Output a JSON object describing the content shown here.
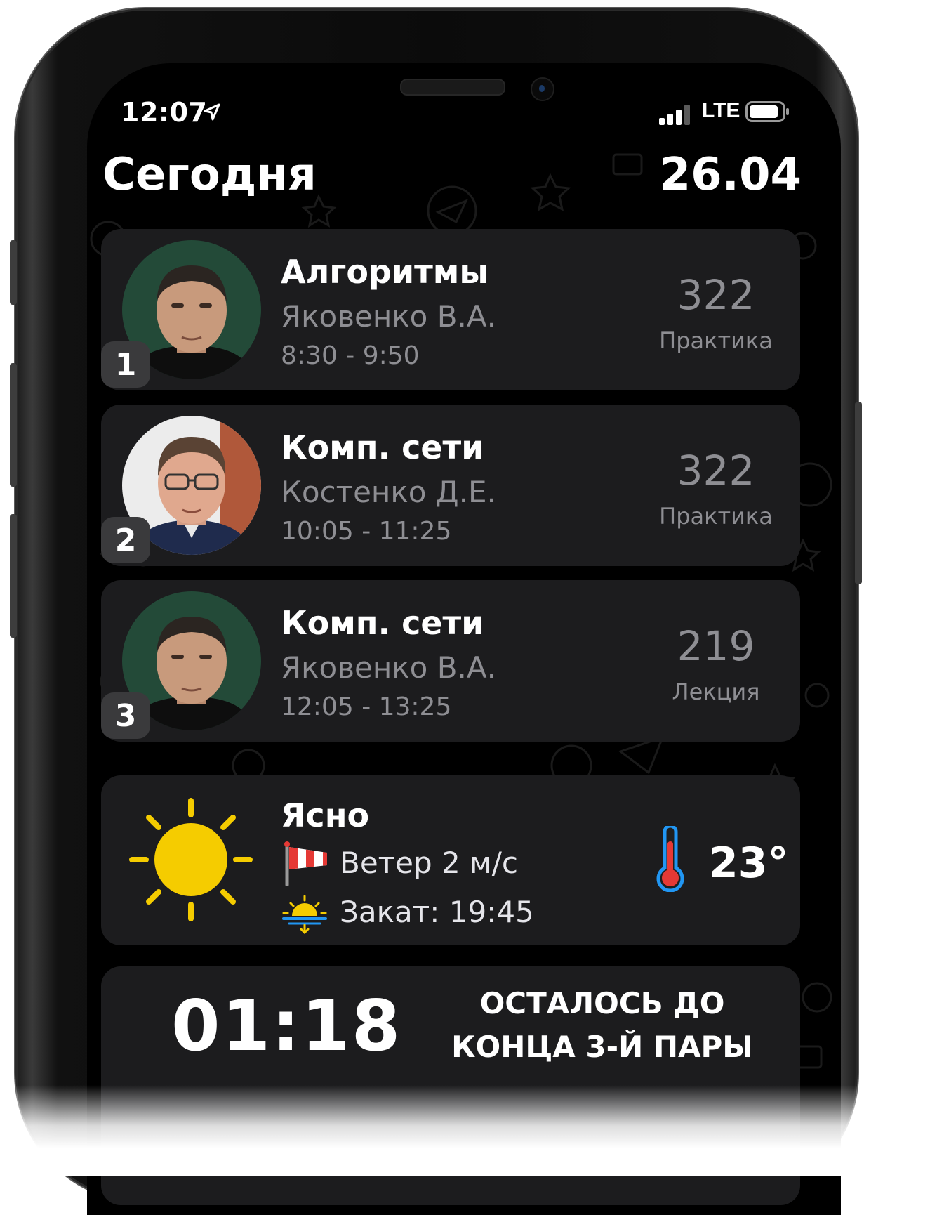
{
  "status_bar": {
    "time": "12:07",
    "network": "LTE",
    "icons": [
      "location-arrow-icon",
      "signal-bars-icon",
      "battery-icon"
    ]
  },
  "header": {
    "title": "Сегодня",
    "date": "26.04"
  },
  "lessons": [
    {
      "number": "1",
      "subject": "Алгоритмы",
      "teacher": "Яковенко В.А.",
      "time": "8:30 - 9:50",
      "room": "322",
      "type": "Практика"
    },
    {
      "number": "2",
      "subject": "Комп. сети",
      "teacher": "Костенко Д.Е.",
      "time": "10:05 - 11:25",
      "room": "322",
      "type": "Практика"
    },
    {
      "number": "3",
      "subject": "Комп. сети",
      "teacher": "Яковенко В.А.",
      "time": "12:05 - 13:25",
      "room": "219",
      "type": "Лекция"
    }
  ],
  "weather": {
    "condition": "Ясно",
    "wind": "Ветер 2 м/с",
    "sunset": "Закат: 19:45",
    "temperature": "23°",
    "icons": [
      "sun-icon",
      "windsock-icon",
      "sunset-icon",
      "thermometer-icon"
    ]
  },
  "timer": {
    "value": "01:18",
    "caption_line1": "ОСТАЛОСЬ ДО",
    "caption_line2": "КОНЦА 3-Й ПАРЫ"
  },
  "colors": {
    "background": "#000000",
    "card": "#1c1c1e",
    "secondary_text": "#8e8e93",
    "sun": "#f5cc00",
    "badge": "#3a3a3c"
  }
}
